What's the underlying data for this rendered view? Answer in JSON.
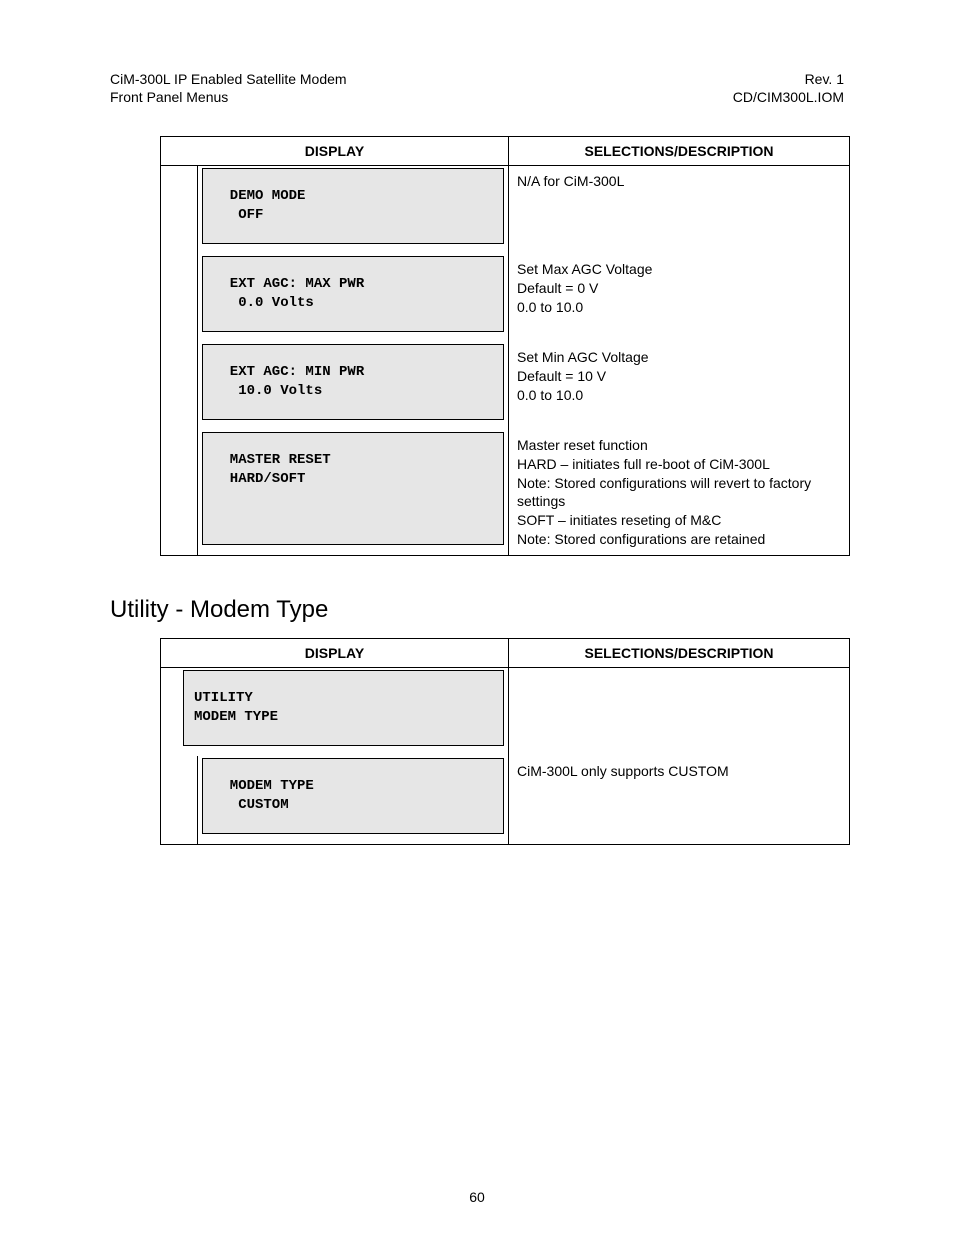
{
  "header": {
    "left_line1": "CiM-300L IP Enabled Satellite Modem",
    "left_line2": "Front Panel Menus",
    "right_line1": "Rev. 1",
    "right_line2": "CD/CIM300L.IOM"
  },
  "table1": {
    "head_display": "DISPLAY",
    "head_desc": "SELECTIONS/DESCRIPTION",
    "rows": [
      {
        "display": "  DEMO MODE\n   OFF",
        "desc": "N/A for CiM-300L"
      },
      {
        "display": "  EXT AGC: MAX PWR\n   0.0 Volts",
        "desc": "Set  Max AGC Voltage\nDefault = 0 V\n0.0 to 10.0"
      },
      {
        "display": "  EXT AGC: MIN PWR\n   10.0 Volts",
        "desc": "Set  Min AGC Voltage\nDefault = 10 V\n0.0 to 10.0"
      },
      {
        "display": "  MASTER RESET\n  HARD/SOFT",
        "desc": "Master reset function\nHARD – initiates full re-boot of CiM-300L\nNote: Stored configurations will revert to factory settings\nSOFT – initiates reseting of M&C\nNote: Stored configurations are retained"
      }
    ]
  },
  "section_heading": "Utility - Modem Type",
  "table2": {
    "head_display": "DISPLAY",
    "head_desc": "SELECTIONS/DESCRIPTION",
    "rows": [
      {
        "indent": false,
        "display": "UTILITY\nMODEM TYPE",
        "desc": ""
      },
      {
        "indent": true,
        "display": "  MODEM TYPE\n   CUSTOM",
        "desc": "CiM-300L only supports CUSTOM"
      }
    ]
  },
  "page_number": "60"
}
